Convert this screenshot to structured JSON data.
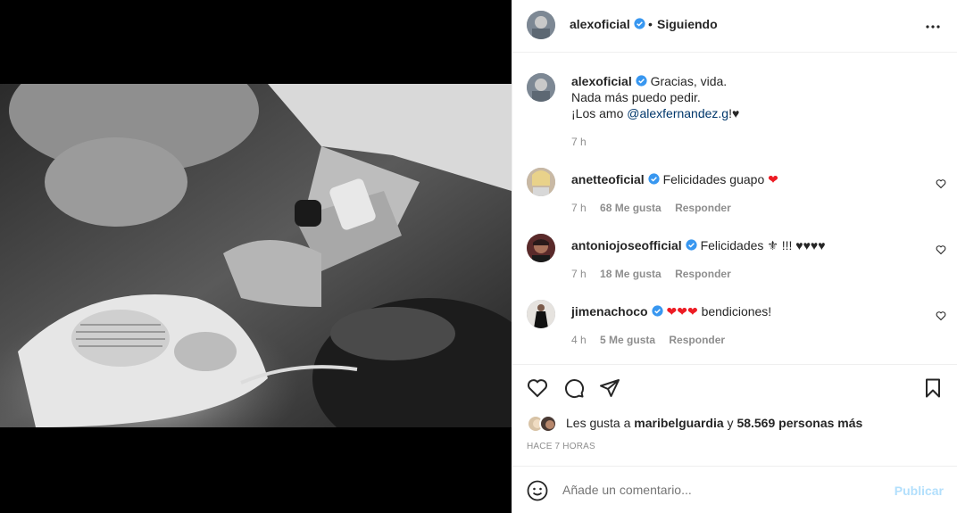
{
  "post": {
    "author": "alexoficial",
    "dot": "•",
    "follow_label": "Siguiendo",
    "caption_lines": [
      "Gracias, vida.",
      "Nada más puedo pedir.",
      "¡Los amo "
    ],
    "caption_mention": "@alexfernandez.g",
    "caption_tail": "!♥",
    "caption_time": "7 h"
  },
  "comments": [
    {
      "user": "anetteoficial",
      "text_before": "Felicidades guapo",
      "emoji": "❤",
      "text_after": "",
      "time": "7 h",
      "likes": "68 Me gusta",
      "reply": "Responder"
    },
    {
      "user": "antoniojoseofficial",
      "text_before": "Felicidades",
      "emoji": "⚜",
      "text_after": "!!! ♥♥♥♥",
      "time": "7 h",
      "likes": "18 Me gusta",
      "reply": "Responder"
    },
    {
      "user": "jimenachoco",
      "text_before": "",
      "emoji": "❤❤❤",
      "text_after": "bendiciones!",
      "time": "4 h",
      "likes": "5 Me gusta",
      "reply": "Responder"
    }
  ],
  "likes": {
    "prefix": "Les gusta a",
    "user": "maribelguardia",
    "joiner": "y",
    "others": "58.569 personas más"
  },
  "time_ago": "HACE 7 HORAS",
  "add_comment": {
    "placeholder": "Añade un comentario...",
    "publish": "Publicar"
  },
  "icons": {
    "verified": "verified-badge-icon",
    "more": "more-options-icon",
    "like": "heart-icon",
    "comment": "comment-icon",
    "share": "paper-plane-icon",
    "save": "bookmark-icon",
    "emoji": "emoji-icon"
  },
  "colors": {
    "verified": "#3897f0",
    "mention": "#00376b",
    "publish_disabled": "#b2dffc",
    "heart_red": "#ed1c24"
  }
}
